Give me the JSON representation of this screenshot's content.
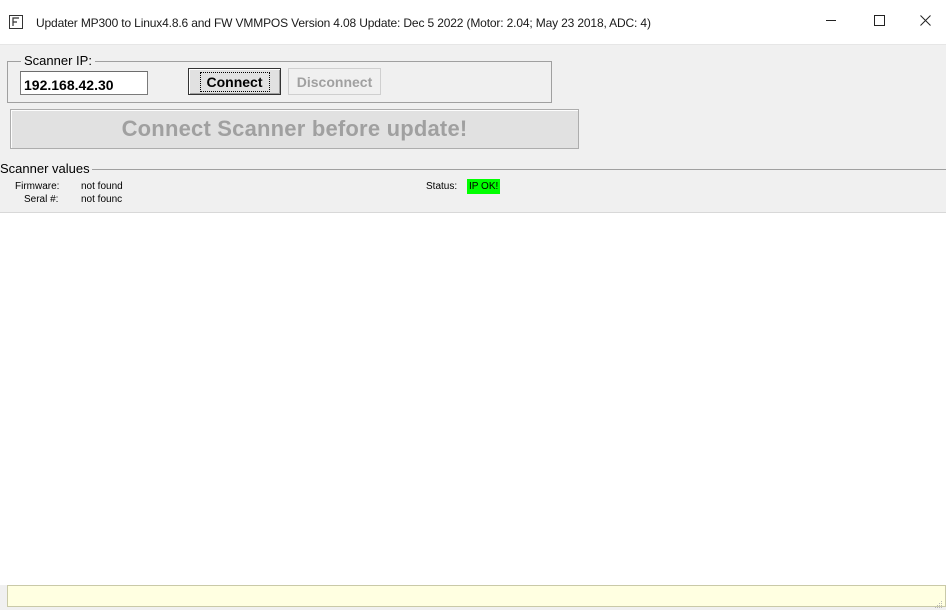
{
  "window": {
    "title": "Updater MP300 to Linux4.8.6 and FW VMMPOS Version 4.08  Update: Dec  5 2022 (Motor: 2.04; May 23 2018, ADC: 4)",
    "icon": "app-icon"
  },
  "scanner_ip": {
    "group_label": "Scanner IP:",
    "ip_value": "192.168.42.30",
    "connect_label": "Connect",
    "disconnect_label": "Disconnect"
  },
  "update_button": {
    "label": "Connect Scanner before update!"
  },
  "scanner_values": {
    "group_label": "Scanner values",
    "firmware_label": "Firmware:",
    "firmware_value": "not found",
    "serial_label": "Seral #:",
    "serial_value": "not founc",
    "status_label": "Status:",
    "status_value": "IP OK!",
    "status_color": "#00ff00"
  },
  "log": {
    "text": ""
  },
  "status_bar": {
    "text": "",
    "background": "#ffffe1"
  }
}
